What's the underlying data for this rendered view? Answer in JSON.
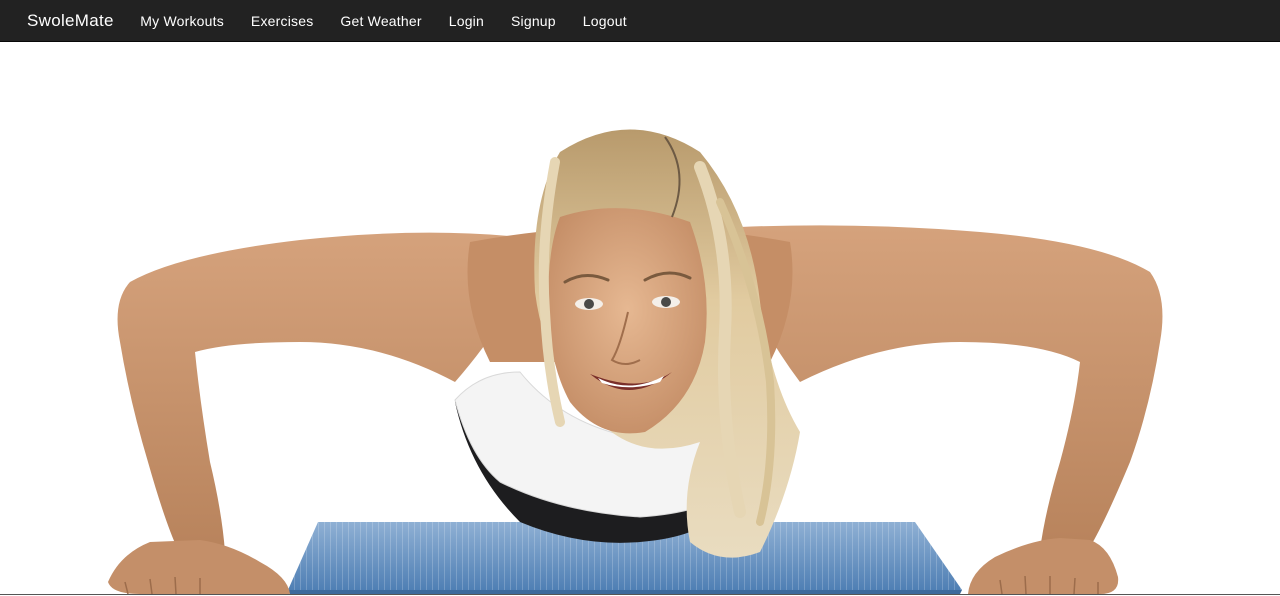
{
  "navbar": {
    "brand": "SwoleMate",
    "links": [
      {
        "label": "My Workouts"
      },
      {
        "label": "Exercises"
      },
      {
        "label": "Get Weather"
      },
      {
        "label": "Login"
      },
      {
        "label": "Signup"
      },
      {
        "label": "Logout"
      }
    ],
    "background": "#222222",
    "text_color": "#ffffff"
  },
  "hero": {
    "subject": "woman doing a push-up on a blue exercise mat, smiling at the camera",
    "mat_color": "#5a87b8",
    "skin_color": "#c9926a",
    "hair_color": "#d9c193",
    "top_color": "#f2f2f2"
  }
}
